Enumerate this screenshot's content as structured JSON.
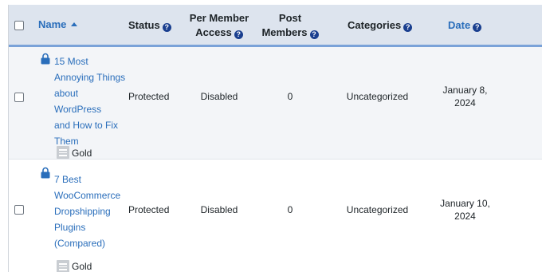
{
  "columns": {
    "name": "Name",
    "status": "Status",
    "per_member_access": [
      "Per Member",
      "Access"
    ],
    "post_members": [
      "Post",
      "Members"
    ],
    "categories": "Categories",
    "date": "Date"
  },
  "help_glyph": "?",
  "rows": [
    {
      "title_lines": [
        "15 Most",
        "Annoying Things",
        "about WordPress",
        "and How to Fix",
        "Them"
      ],
      "level": "Gold",
      "status": "Protected",
      "per_member_access": "Disabled",
      "post_members": "0",
      "categories": "Uncategorized",
      "date_lines": [
        "January 8,",
        "2024"
      ]
    },
    {
      "title_lines": [
        "7 Best",
        "WooCommerce",
        "Dropshipping",
        "Plugins",
        "(Compared)"
      ],
      "level": "Gold",
      "status": "Protected",
      "per_member_access": "Disabled",
      "post_members": "0",
      "categories": "Uncategorized",
      "date_lines": [
        "January 10,",
        "2024"
      ]
    }
  ]
}
